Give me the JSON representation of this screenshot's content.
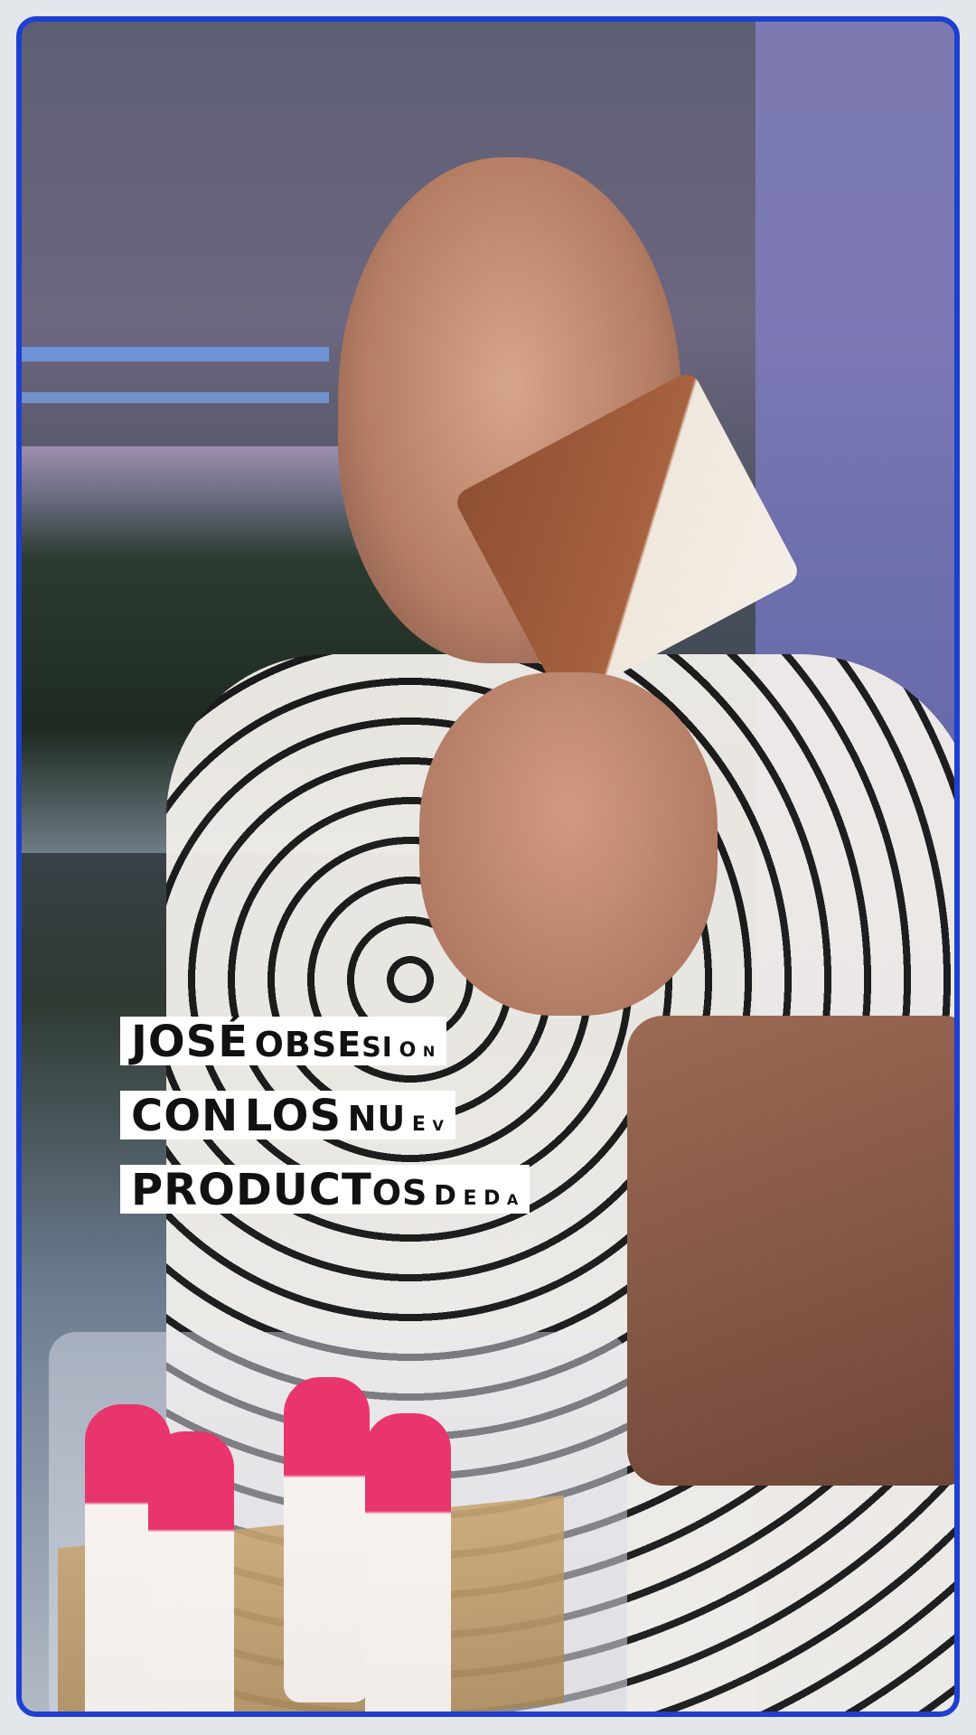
{
  "caption": {
    "line1": {
      "w1": "JOSÉ",
      "a": "OBSE",
      "b": "SI",
      "c": "O",
      "d": "N"
    },
    "line2": {
      "w1": "CON",
      "w2": "LOS",
      "a": "NU",
      "b": "E",
      "c": "V"
    },
    "line3": {
      "w1": "PRODUCT",
      "a": "OS",
      "b": "D",
      "c": "E",
      "d": "D",
      "e": "A"
    }
  },
  "colors": {
    "frame": "#1f3fd1",
    "caption_bg": "#ffffff",
    "caption_text": "#111111"
  }
}
